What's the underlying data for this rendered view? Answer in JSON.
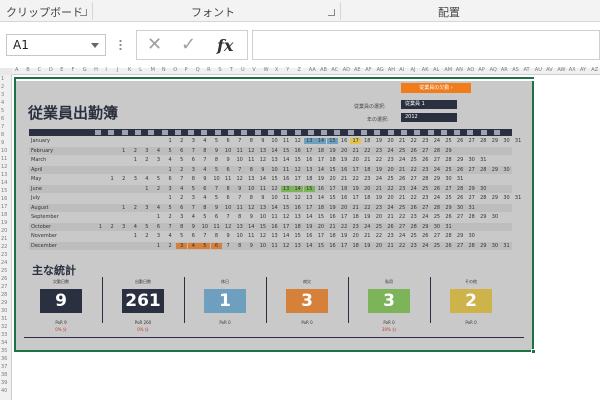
{
  "ribbon": {
    "groups": [
      "クリップボード",
      "フォント",
      "配置"
    ]
  },
  "formula_bar": {
    "name_box": "A1",
    "cancel_icon": "cross-icon",
    "enter_icon": "check-icon",
    "fx_label": "fx",
    "formula": ""
  },
  "grid": {
    "columns": [
      "A",
      "B",
      "C",
      "D",
      "E",
      "F",
      "G",
      "H",
      "I",
      "J",
      "K",
      "L",
      "M",
      "N",
      "O",
      "P",
      "Q",
      "R",
      "S",
      "T",
      "U",
      "V",
      "W",
      "X",
      "Y",
      "Z",
      "AA",
      "AB",
      "AC",
      "AD",
      "AE",
      "AF",
      "AG",
      "AH",
      "AI",
      "AJ",
      "AK",
      "AL",
      "AM",
      "AN",
      "AO",
      "AP",
      "AQ",
      "AR",
      "AS",
      "AT",
      "AU",
      "AV",
      "AW",
      "AX",
      "AY",
      "AZ"
    ],
    "rows": [
      "1",
      "2",
      "3",
      "4",
      "5",
      "6",
      "7",
      "8",
      "9",
      "10",
      "11",
      "12",
      "13",
      "14",
      "15",
      "16",
      "17",
      "18",
      "19",
      "20",
      "21",
      "22",
      "23",
      "24",
      "25",
      "26",
      "27",
      "28",
      "29",
      "30",
      "31",
      "32",
      "33",
      "34",
      "35",
      "36",
      "37",
      "38",
      "39",
      "40"
    ]
  },
  "sheet": {
    "title": "従業員出勤簿",
    "cta": "従業員の欠勤 ›",
    "employee_label": "従業員の選択:",
    "employee_value": "従業員 1",
    "year_label": "年の選択:",
    "year_value": "2012",
    "months": [
      "January",
      "February",
      "March",
      "April",
      "May",
      "June",
      "July",
      "August",
      "September",
      "October",
      "November",
      "December"
    ],
    "stats_title": "主な統計",
    "stats": [
      {
        "caption": "欠勤日数",
        "value": "9",
        "sub": "PoR 9",
        "sub2": "0% 分",
        "color": "#2b3040"
      },
      {
        "caption": "出勤日数",
        "value": "261",
        "sub": "PoR 260",
        "sub2": "0% 分",
        "color": "#2b3040"
      },
      {
        "caption": "休日",
        "value": "1",
        "sub": "PoR 0",
        "sub2": "",
        "color": "#6f9fbf"
      },
      {
        "caption": "病欠",
        "value": "3",
        "sub": "PoR 0",
        "sub2": "",
        "color": "#d5813a"
      },
      {
        "caption": "私用",
        "value": "3",
        "sub": "PoR 0",
        "sub2": "30% 分",
        "color": "#7db45a"
      },
      {
        "caption": "その他",
        "value": "2",
        "sub": "PoR 0",
        "sub2": "",
        "color": "#cdb34a"
      }
    ]
  }
}
